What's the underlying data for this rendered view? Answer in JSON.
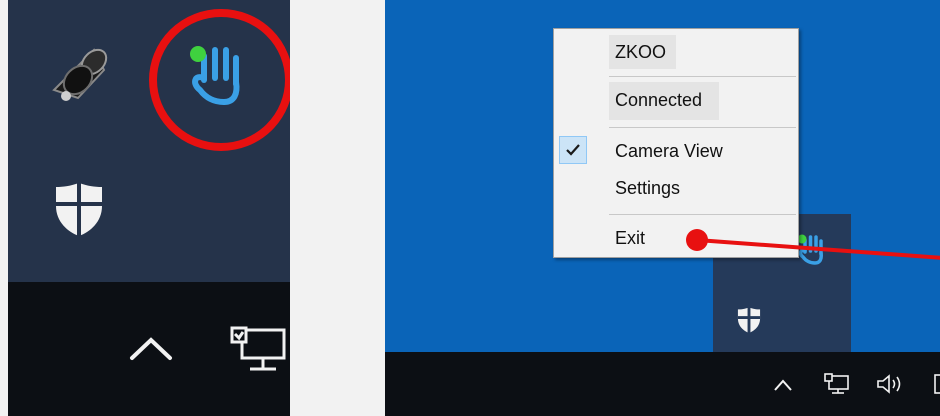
{
  "context_menu": {
    "items": [
      {
        "label": "ZKOO",
        "enabled": false
      },
      {
        "label": "Connected",
        "enabled": false
      },
      {
        "label": "Camera View",
        "checked": true
      },
      {
        "label": "Settings"
      },
      {
        "label": "Exit"
      }
    ]
  },
  "icons": {
    "speaker_app": "speaker-icon",
    "zkoo": "hand-icon",
    "defender": "shield-icon",
    "show_hidden": "chevron-up-icon",
    "network": "network-icon",
    "volume": "volume-icon"
  },
  "colors": {
    "highlight": "#e81010",
    "hand_icon": "#3aa0e6",
    "status_dot": "#3fd13f",
    "desktop": "#0a64b8",
    "taskbar": "#0c0f14"
  }
}
